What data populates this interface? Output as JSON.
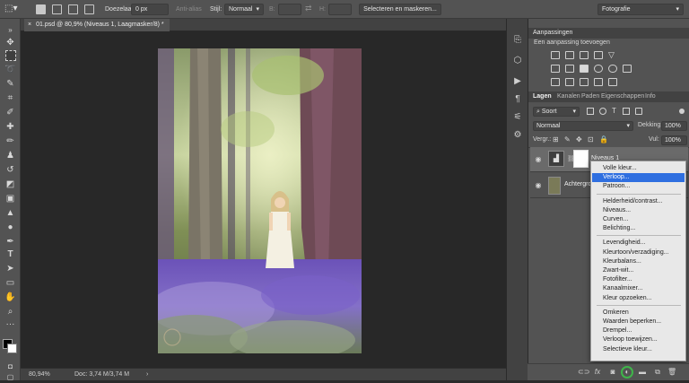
{
  "options_bar": {
    "feather_label": "Doezelaar:",
    "feather_value": "0 px",
    "antialias_label": "Anti-alias",
    "style_label": "Stijl:",
    "style_value": "Normaal",
    "width_label": "B:",
    "height_label": "H:",
    "select_mask_label": "Selecteren en maskeren...",
    "workspace_value": "Fotografie"
  },
  "document": {
    "tab_title": "01.psd @ 80,9% (Niveaus 1, Laagmasker/8) *",
    "zoom": "80,94%",
    "doc_size": "Doc: 3,74 M/3,74 M"
  },
  "adjustments_panel": {
    "title": "Aanpassingen",
    "subtitle": "Een aanpassing toevoegen"
  },
  "layers_panel": {
    "tabs": [
      "Lagen",
      "Kanalen",
      "Paden",
      "Eigenschappen",
      "Info"
    ],
    "filter_label": "Soort",
    "blend_mode": "Normaal",
    "opacity_label": "Dekking:",
    "opacity_value": "100%",
    "lock_label": "Vergr.:",
    "fill_label": "Vul:",
    "fill_value": "100%",
    "layers": [
      {
        "name": "Niveaus 1"
      },
      {
        "name": "Achtergrond"
      }
    ]
  },
  "context_menu": {
    "groups": [
      [
        "Volle kleur...",
        "Verloop...",
        "Patroon..."
      ],
      [
        "Helderheid/contrast...",
        "Niveaus...",
        "Curven...",
        "Belichting..."
      ],
      [
        "Levendigheid...",
        "Kleurtoon/verzadiging...",
        "Kleurbalans...",
        "Zwart-wit...",
        "Fotofilter...",
        "Kanaalmixer...",
        "Kleur opzoeken..."
      ],
      [
        "Omkeren",
        "Waarden beperken...",
        "Drempel...",
        "Verloop toewijzen...",
        "Selectieve kleur..."
      ]
    ],
    "selected": "Verloop..."
  },
  "colors": {
    "menu_highlight": "#2f6fe0",
    "ring_highlight": "#3fb54a"
  }
}
